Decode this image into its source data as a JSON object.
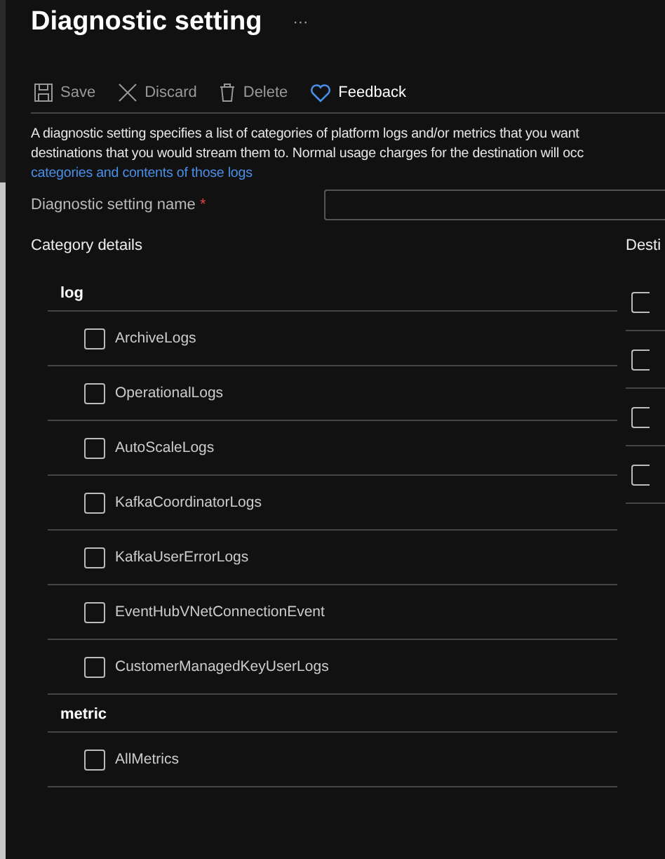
{
  "title": "Diagnostic setting",
  "more": "···",
  "toolbar": [
    {
      "label": "Save",
      "disabled": true
    },
    {
      "label": "Discard",
      "disabled": true
    },
    {
      "label": "Delete",
      "disabled": true
    },
    {
      "label": "Feedback",
      "disabled": false
    }
  ],
  "description": {
    "lines": [
      "A diagnostic setting specifies a list of categories of platform logs and/or metrics that you want",
      "destinations that you would stream them to. Normal usage charges for the destination will occ"
    ],
    "link": "categories and contents of those logs"
  },
  "name_field": {
    "label": "Diagnostic setting name",
    "required_mark": "*"
  },
  "category_details": {
    "heading": "Category details",
    "groups": [
      {
        "name": "log",
        "items": [
          {
            "label": "ArchiveLogs",
            "checked": false
          },
          {
            "label": "OperationalLogs",
            "checked": false
          },
          {
            "label": "AutoScaleLogs",
            "checked": false
          },
          {
            "label": "KafkaCoordinatorLogs",
            "checked": false
          },
          {
            "label": "KafkaUserErrorLogs",
            "checked": false
          },
          {
            "label": "EventHubVNetConnectionEvent",
            "checked": false
          },
          {
            "label": "CustomerManagedKeyUserLogs",
            "checked": false
          }
        ]
      },
      {
        "name": "metric",
        "items": [
          {
            "label": "AllMetrics",
            "checked": false
          }
        ]
      }
    ]
  },
  "destination_details": {
    "heading": "Desti",
    "options": [
      {
        "checked": false
      },
      {
        "checked": false
      },
      {
        "checked": false
      },
      {
        "checked": false
      }
    ]
  }
}
